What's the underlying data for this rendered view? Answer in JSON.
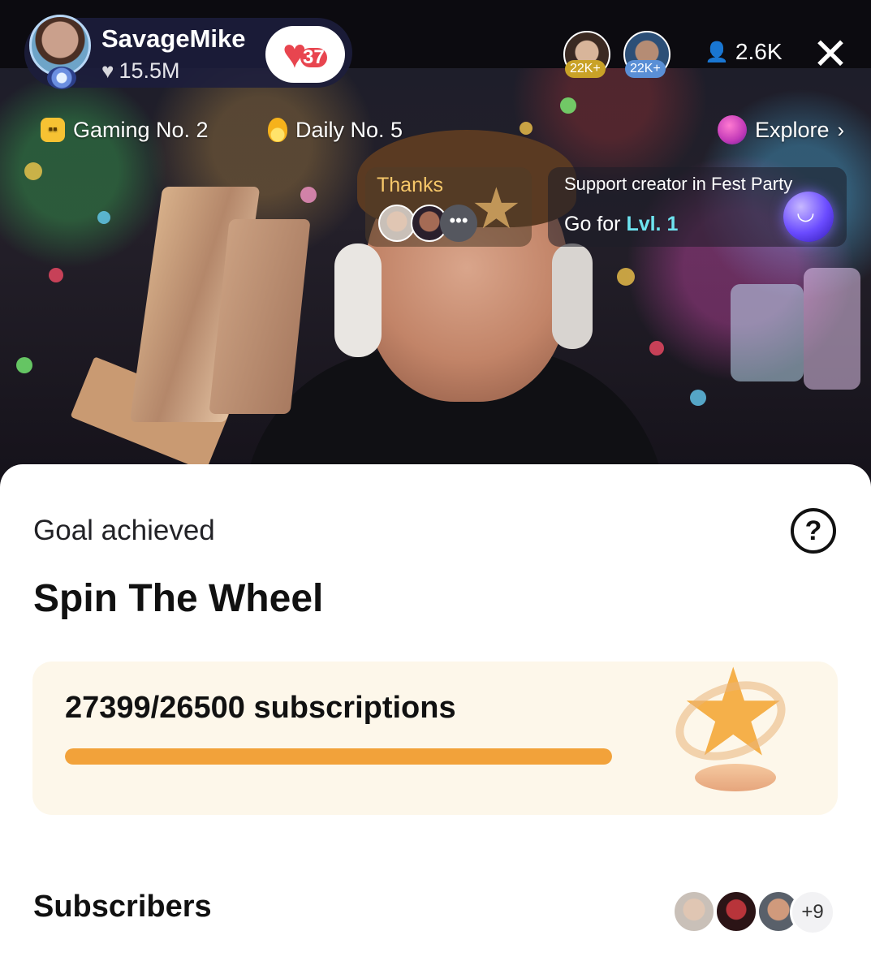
{
  "creator": {
    "name": "SavageMike",
    "likes": "15.5M",
    "level": "37"
  },
  "viewers": {
    "top": [
      {
        "badge": "22K+",
        "badge_color": "#c9a227"
      },
      {
        "badge": "22K+",
        "badge_color": "#5a8fd6"
      }
    ],
    "count": "2.6K"
  },
  "ranks": [
    {
      "label": "Gaming No. 2",
      "icon": "gamepad-icon"
    },
    {
      "label": "Daily No. 5",
      "icon": "flame-icon"
    }
  ],
  "explore": {
    "label": "Explore",
    "icon": "planet-icon"
  },
  "thanks": {
    "title": "Thanks",
    "more": "•••"
  },
  "fest": {
    "title": "Support creator in Fest Party",
    "cta_prefix": "Go for",
    "cta_level": "Lvl. 1"
  },
  "goal": {
    "status": "Goal achieved",
    "help_icon": "question-icon",
    "title": "Spin The Wheel",
    "count_text": "27399/26500 subscriptions",
    "progress": 1.0,
    "accent": "#f2a23a"
  },
  "subscribers": {
    "label": "Subscribers",
    "more": "+9"
  }
}
